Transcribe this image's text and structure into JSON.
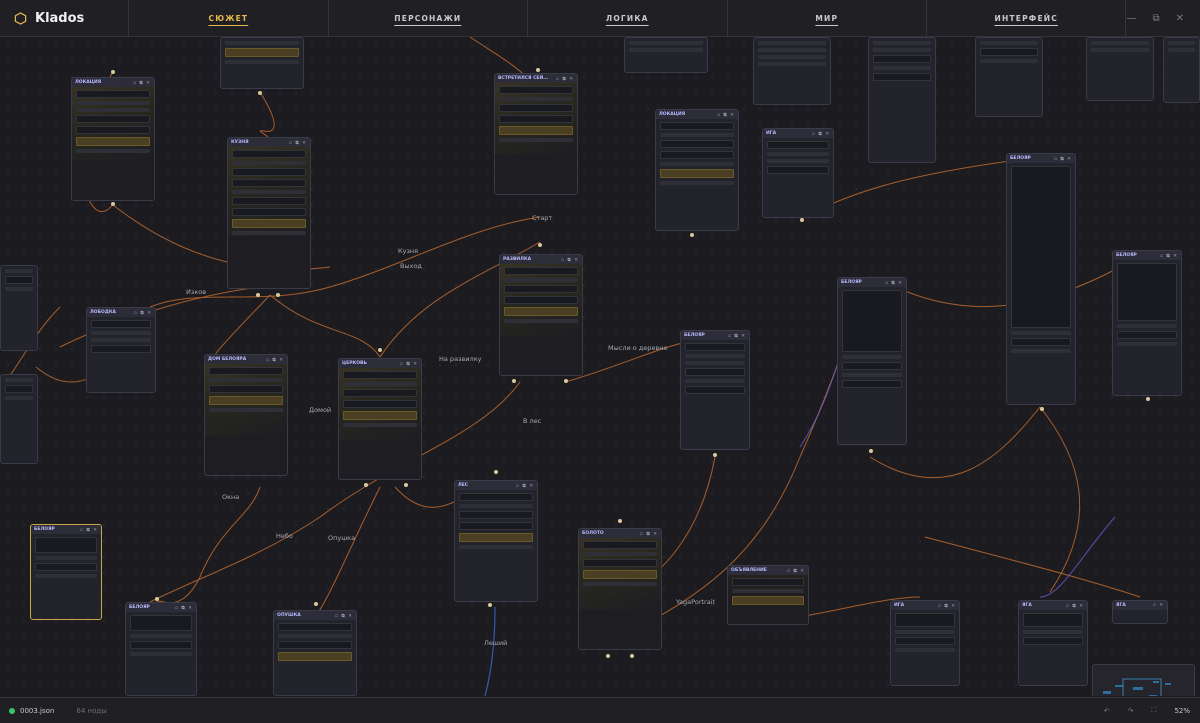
{
  "app": {
    "name": "Klados"
  },
  "tabs": [
    {
      "label": "СЮЖЕТ",
      "active": true
    },
    {
      "label": "ПЕРСОНАЖИ",
      "active": false
    },
    {
      "label": "ЛОГИКА",
      "active": false
    },
    {
      "label": "МИР",
      "active": false
    },
    {
      "label": "ИНТЕРФЕЙС",
      "active": false
    }
  ],
  "window": {
    "minimize": "—",
    "maximize": "⧉",
    "close": "✕"
  },
  "status": {
    "file": "0003.json",
    "nodes": "64 ноды",
    "zoom": "52%"
  },
  "colors": {
    "accent": "#e8b84a",
    "wire": "#c06a2e",
    "status_ok": "#3ac76b"
  },
  "nodes": [
    {
      "title": "ЛОКАЦИЯ"
    },
    {
      "title": "КУЗНЯ"
    },
    {
      "title": "ВСТРЕТИЛСЯ СЕЙ..."
    },
    {
      "title": "ЛОКАЦИЯ"
    },
    {
      "title": "ИГА"
    },
    {
      "title": "ЛОБОДКА"
    },
    {
      "title": "РАЗВИЛКА"
    },
    {
      "title": "ДОМ БЕЛОЯРА"
    },
    {
      "title": "ЦЕРКОВЬ"
    },
    {
      "title": "БЕЛОЯР"
    },
    {
      "title": "БЕЛОЯР"
    },
    {
      "title": "БЕЛОЯР"
    },
    {
      "title": "БЕЛОЯР"
    },
    {
      "title": "ЛЕС"
    },
    {
      "title": "БОЛОТО"
    },
    {
      "title": "ОБЪЯВЛЕНИЕ"
    },
    {
      "title": "БЕЛОЯР"
    },
    {
      "title": "БЕЛОЯР"
    },
    {
      "title": "ОПУШКА"
    },
    {
      "title": "ИГА"
    },
    {
      "title": "ЯГА"
    },
    {
      "title": "ЯГА"
    }
  ],
  "edge_labels": [
    "Старт",
    "Кузня",
    "Выход",
    "Изков",
    "Мысли о деревне",
    "На развилку",
    "Домой",
    "В лес",
    "Окна",
    "Небо",
    "Опушка",
    "YagaPortrait",
    "Леший"
  ]
}
